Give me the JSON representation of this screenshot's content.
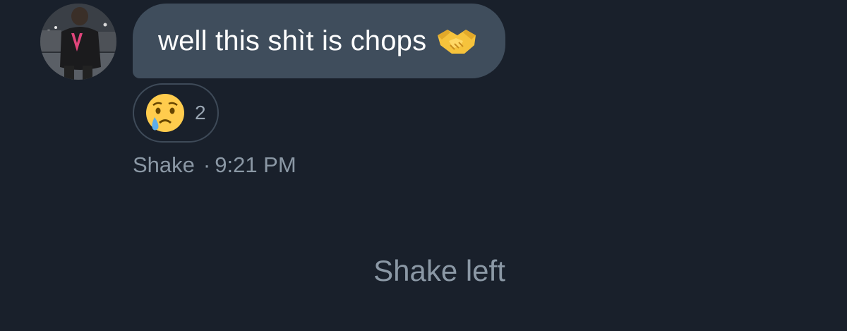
{
  "message": {
    "sender": "Shake",
    "text": "well this shìt is chops",
    "inline_emoji": "handshake-icon",
    "time": "9:21 PM",
    "separator": "·"
  },
  "reaction": {
    "emoji": "crying-face-icon",
    "count": "2"
  },
  "event": {
    "text": "Shake left"
  },
  "colors": {
    "background": "#19202b",
    "bubble": "#3f4d5c",
    "muted_text": "#8b98a5",
    "accent_pink": "#e0457b"
  }
}
